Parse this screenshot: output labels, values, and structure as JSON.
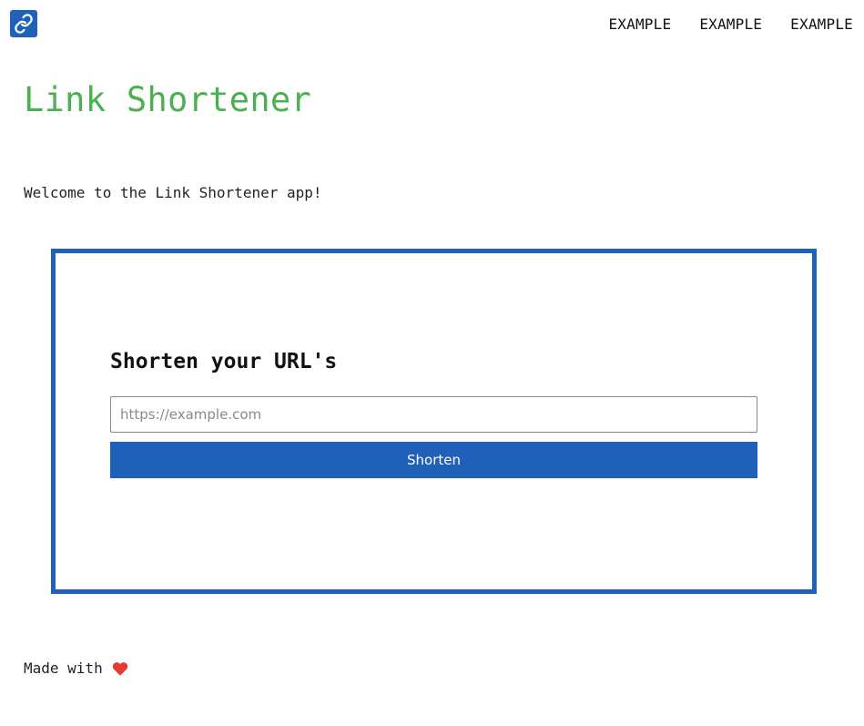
{
  "header": {
    "logo_icon": "link-icon",
    "logo_color": "#2060b8",
    "nav": [
      "EXAMPLE",
      "EXAMPLE",
      "EXAMPLE"
    ]
  },
  "main": {
    "title": "Link Shortener",
    "title_color": "#4caf50",
    "welcome": "Welcome to the Link Shortener app!"
  },
  "form": {
    "heading": "Shorten your URL's",
    "input_value": "",
    "input_placeholder": "https://example.com",
    "button_label": "Shorten",
    "accent_color": "#2060b8"
  },
  "footer": {
    "text": "Made with",
    "icon": "heart-icon",
    "heart_color": "#e53935"
  }
}
